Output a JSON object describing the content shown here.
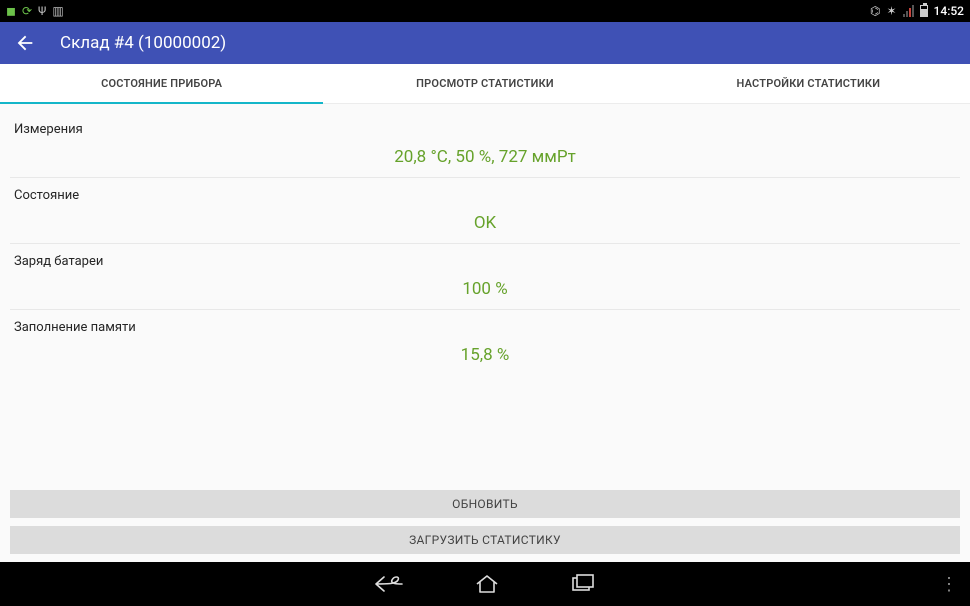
{
  "statusbar": {
    "clock": "14:52"
  },
  "appbar": {
    "title": "Склад #4 (10000002)"
  },
  "tabs": [
    {
      "label": "СОСТОЯНИЕ ПРИБОРА"
    },
    {
      "label": "ПРОСМОТР СТАТИСТИКИ"
    },
    {
      "label": "НАСТРОЙКИ СТАТИСТИКИ"
    }
  ],
  "rows": {
    "measure_label": "Измерения",
    "measure_value": "20,8 °C, 50 %, 727 ммРт",
    "state_label": "Состояние",
    "state_value": "OK",
    "battery_label": "Заряд батареи",
    "battery_value": "100 %",
    "memory_label": "Заполнение памяти",
    "memory_value": "15,8 %"
  },
  "actions": {
    "refresh": "ОБНОВИТЬ",
    "download": "ЗАГРУЗИТЬ СТАТИСТИКУ"
  }
}
